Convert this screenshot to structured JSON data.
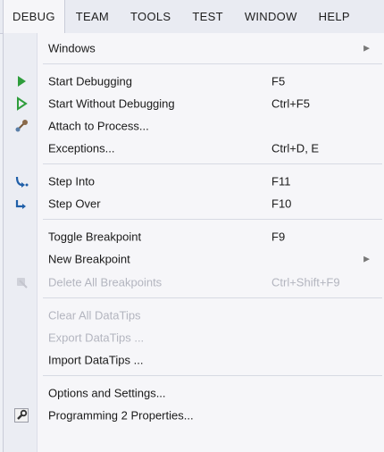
{
  "menubar": {
    "items": [
      {
        "label": "DEBUG"
      },
      {
        "label": "TEAM"
      },
      {
        "label": "TOOLS"
      },
      {
        "label": "TEST"
      },
      {
        "label": "WINDOW"
      },
      {
        "label": "HELP"
      }
    ]
  },
  "menu": {
    "items": [
      {
        "label": "Windows",
        "shortcut": "",
        "submenu": true,
        "enabled": true,
        "icon": ""
      },
      {
        "label": "Start Debugging",
        "shortcut": "F5",
        "submenu": false,
        "enabled": true,
        "icon": "start-debugging-icon"
      },
      {
        "label": "Start Without Debugging",
        "shortcut": "Ctrl+F5",
        "submenu": false,
        "enabled": true,
        "icon": "start-without-debugging-icon"
      },
      {
        "label": "Attach to Process...",
        "shortcut": "",
        "submenu": false,
        "enabled": true,
        "icon": "attach-process-icon"
      },
      {
        "label": "Exceptions...",
        "shortcut": "Ctrl+D, E",
        "submenu": false,
        "enabled": true,
        "icon": ""
      },
      {
        "label": "Step Into",
        "shortcut": "F11",
        "submenu": false,
        "enabled": true,
        "icon": "step-into-icon"
      },
      {
        "label": "Step Over",
        "shortcut": "F10",
        "submenu": false,
        "enabled": true,
        "icon": "step-over-icon"
      },
      {
        "label": "Toggle Breakpoint",
        "shortcut": "F9",
        "submenu": false,
        "enabled": true,
        "icon": ""
      },
      {
        "label": "New Breakpoint",
        "shortcut": "",
        "submenu": true,
        "enabled": true,
        "icon": ""
      },
      {
        "label": "Delete All Breakpoints",
        "shortcut": "Ctrl+Shift+F9",
        "submenu": false,
        "enabled": false,
        "icon": "delete-breakpoints-icon"
      },
      {
        "label": "Clear All DataTips",
        "shortcut": "",
        "submenu": false,
        "enabled": false,
        "icon": ""
      },
      {
        "label": "Export DataTips ...",
        "shortcut": "",
        "submenu": false,
        "enabled": false,
        "icon": ""
      },
      {
        "label": "Import DataTips ...",
        "shortcut": "",
        "submenu": false,
        "enabled": true,
        "icon": ""
      },
      {
        "label": "Options and Settings...",
        "shortcut": "",
        "submenu": false,
        "enabled": true,
        "icon": ""
      },
      {
        "label": "Programming 2 Properties...",
        "shortcut": "",
        "submenu": false,
        "enabled": true,
        "icon": "wrench-icon"
      }
    ]
  },
  "colors": {
    "play_green": "#2e9d3c",
    "icon_blue": "#1f5fa8",
    "disabled_text": "#b3b5bf"
  }
}
